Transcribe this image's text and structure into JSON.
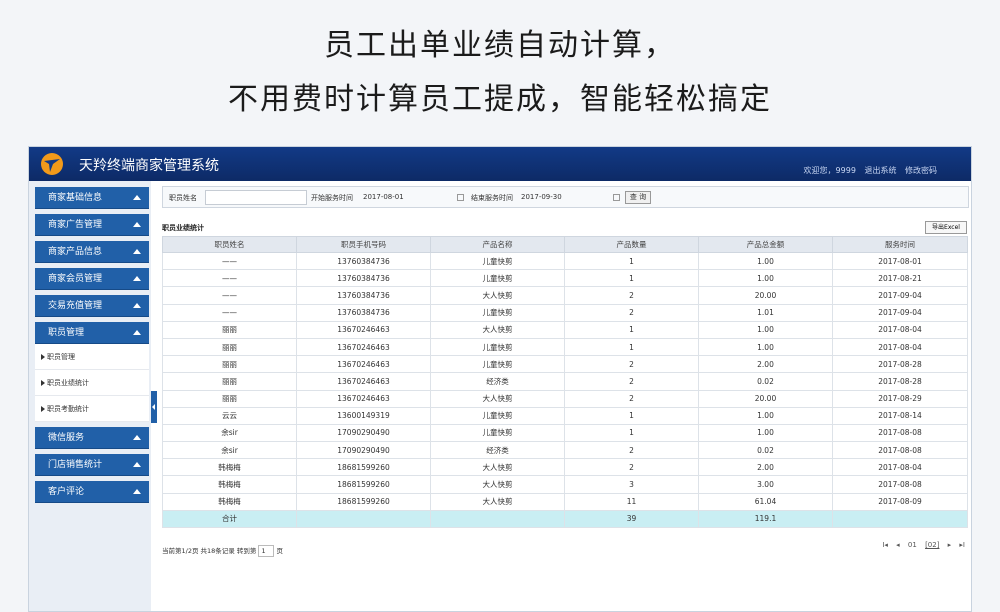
{
  "headline": {
    "line1": "员工出单业绩自动计算，",
    "line2": "不用费时计算员工提成，智能轻松搞定"
  },
  "app": {
    "title": "天羚终端商家管理系统",
    "welcome": "欢迎您，9999",
    "logout": "退出系统",
    "change_password": "修改密码"
  },
  "sidebar": {
    "items": [
      {
        "label": "商家基础信息"
      },
      {
        "label": "商家广告管理"
      },
      {
        "label": "商家产品信息"
      },
      {
        "label": "商家会员管理"
      },
      {
        "label": "交易充值管理"
      },
      {
        "label": "职员管理"
      },
      {
        "label": "微信服务"
      },
      {
        "label": "门店销售统计"
      },
      {
        "label": "客户评论"
      }
    ],
    "submenu": [
      {
        "label": "职员管理"
      },
      {
        "label": "职员业绩统计"
      },
      {
        "label": "职员考勤统计"
      }
    ]
  },
  "filter": {
    "name_label": "职员姓名",
    "name_value": "",
    "start_label": "开始服务时间",
    "start_value": "2017-08-01",
    "end_label": "结束服务时间",
    "end_value": "2017-09-30",
    "query_button": "查 询"
  },
  "section_title": "职员业绩统计",
  "export_button": "导出Excel",
  "table": {
    "headers": [
      "职员姓名",
      "职员手机号码",
      "产品名称",
      "产品数量",
      "产品总金额",
      "服务时间"
    ],
    "rows": [
      [
        "——",
        "13760384736",
        "儿童快剪",
        "1",
        "1.00",
        "2017-08-01"
      ],
      [
        "——",
        "13760384736",
        "儿童快剪",
        "1",
        "1.00",
        "2017-08-21"
      ],
      [
        "——",
        "13760384736",
        "大人快剪",
        "2",
        "20.00",
        "2017-09-04"
      ],
      [
        "——",
        "13760384736",
        "儿童快剪",
        "2",
        "1.01",
        "2017-09-04"
      ],
      [
        "丽丽",
        "13670246463",
        "大人快剪",
        "1",
        "1.00",
        "2017-08-04"
      ],
      [
        "丽丽",
        "13670246463",
        "儿童快剪",
        "1",
        "1.00",
        "2017-08-04"
      ],
      [
        "丽丽",
        "13670246463",
        "儿童快剪",
        "2",
        "2.00",
        "2017-08-28"
      ],
      [
        "丽丽",
        "13670246463",
        "经济类",
        "2",
        "0.02",
        "2017-08-28"
      ],
      [
        "丽丽",
        "13670246463",
        "大人快剪",
        "2",
        "20.00",
        "2017-08-29"
      ],
      [
        "云云",
        "13600149319",
        "儿童快剪",
        "1",
        "1.00",
        "2017-08-14"
      ],
      [
        "余sir",
        "17090290490",
        "儿童快剪",
        "1",
        "1.00",
        "2017-08-08"
      ],
      [
        "余sir",
        "17090290490",
        "经济类",
        "2",
        "0.02",
        "2017-08-08"
      ],
      [
        "韩梅梅",
        "18681599260",
        "大人快剪",
        "2",
        "2.00",
        "2017-08-04"
      ],
      [
        "韩梅梅",
        "18681599260",
        "大人快剪",
        "3",
        "3.00",
        "2017-08-08"
      ],
      [
        "韩梅梅",
        "18681599260",
        "大人快剪",
        "11",
        "61.04",
        "2017-08-09"
      ]
    ],
    "total": [
      "合计",
      "",
      "",
      "39",
      "119.1",
      ""
    ]
  },
  "pager": {
    "info": "当前第1/2页 共18条记录 转到第",
    "page_input": "1",
    "page_suffix": "页",
    "first": "I◂",
    "prev": "◂",
    "current": "01",
    "next_page": "[02]",
    "next": "▸",
    "last": "▸I"
  }
}
